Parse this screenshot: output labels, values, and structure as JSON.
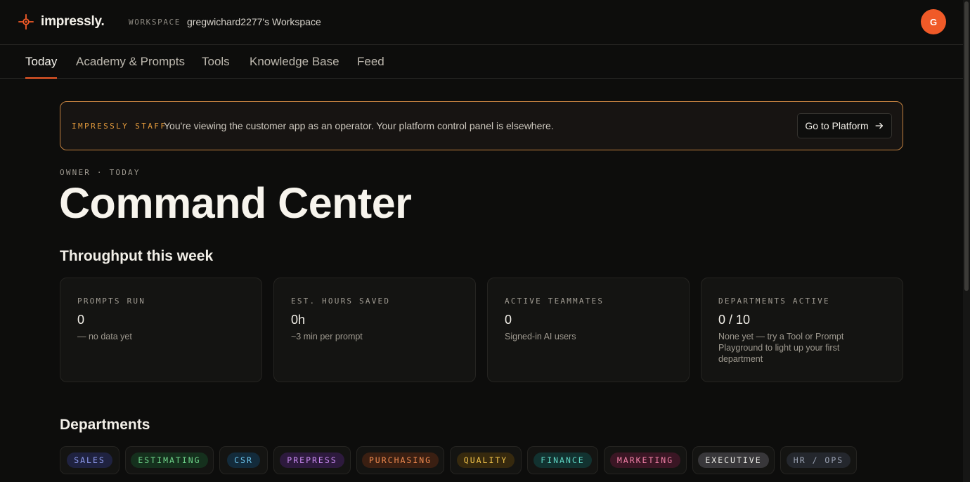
{
  "app": {
    "brand": "impressly."
  },
  "workspace": {
    "label": "WORKSPACE",
    "name": "gregwichard2277's Workspace"
  },
  "user": {
    "initial": "G"
  },
  "tabs": [
    {
      "label": "Today",
      "active": true
    },
    {
      "label": "Academy & Prompts",
      "active": false
    },
    {
      "label": "Tools",
      "active": false
    },
    {
      "label": "Knowledge Base",
      "active": false
    },
    {
      "label": "Feed",
      "active": false
    }
  ],
  "banner": {
    "tag": "IMPRESSLY STAFF",
    "text": "You're viewing the customer app as an operator. Your platform control panel is elsewhere.",
    "button_label": "Go to Platform"
  },
  "header": {
    "eyebrow": "OWNER · TODAY",
    "title": "Command Center"
  },
  "throughput": {
    "title": "Throughput this week",
    "cards": [
      {
        "label": "PROMPTS RUN",
        "value": "0",
        "note": "—  no data yet"
      },
      {
        "label": "EST. HOURS SAVED",
        "value": "0h",
        "note": "~3 min per prompt"
      },
      {
        "label": "ACTIVE TEAMMATES",
        "value": "0",
        "note": "Signed-in AI users"
      },
      {
        "label": "DEPARTMENTS ACTIVE",
        "value": "0 / 10",
        "note": "None yet — try a Tool or Prompt Playground to light up your first department"
      }
    ]
  },
  "departments": {
    "title": "Departments",
    "items": [
      {
        "label": "SALES",
        "color": "#8f9cf0",
        "bg": "#1f2240"
      },
      {
        "label": "ESTIMATING",
        "color": "#6fd58a",
        "bg": "#15301d"
      },
      {
        "label": "CSR",
        "color": "#6cc4ec",
        "bg": "#132b3b"
      },
      {
        "label": "PREPRESS",
        "color": "#c889f0",
        "bg": "#2d1a3d"
      },
      {
        "label": "PURCHASING",
        "color": "#f08a4e",
        "bg": "#3a1f12"
      },
      {
        "label": "QUALITY",
        "color": "#f2c44a",
        "bg": "#36290e"
      },
      {
        "label": "FINANCE",
        "color": "#5fd6c4",
        "bg": "#123230"
      },
      {
        "label": "MARKETING",
        "color": "#f07fa6",
        "bg": "#3a1624"
      },
      {
        "label": "EXECUTIVE",
        "color": "#ecebe6",
        "bg": "#38373a"
      },
      {
        "label": "HR / OPS",
        "color": "#9ba3b4",
        "bg": "#24272d"
      }
    ]
  },
  "colors": {
    "accent": "#f05a28",
    "staff": "#e39a3c",
    "background": "#0d0d0c"
  }
}
